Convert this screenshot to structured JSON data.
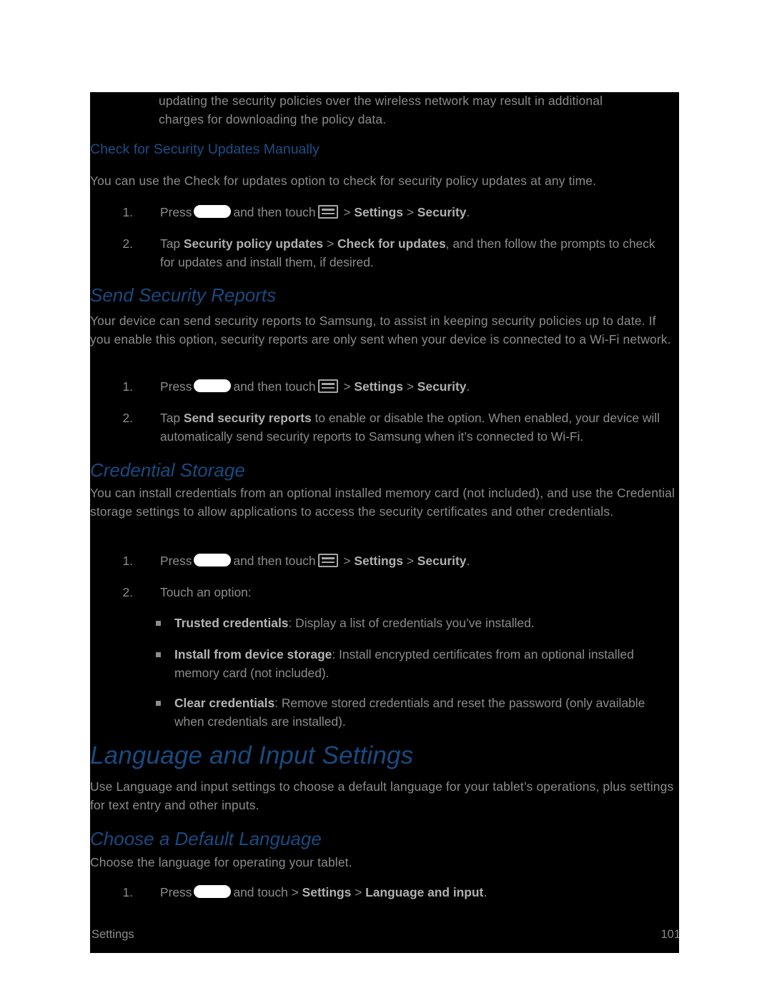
{
  "page": {
    "background_color": "#ffffff",
    "sheet_color": "#000000",
    "body_text_color": "#8c8c8c",
    "heading_color": "#1a4a80"
  },
  "intro": {
    "continued_paragraph": "updating the security policies over the wireless network may result in additional charges for downloading the policy data."
  },
  "section_check_updates": {
    "heading": "Check for Security Updates Manually",
    "paragraph": "You can use the Check for updates option to check for security policy updates at any time.",
    "steps": [
      {
        "number": "1.",
        "before_home": "Press",
        "between_keys": "and then touch",
        "after_menu_plain": " > ",
        "bold_1": "Settings",
        "sep": " > ",
        "bold_2": "Security",
        "tail": "."
      },
      {
        "number": "2.",
        "text_lead": "Tap ",
        "bold_1": "Security policy updates",
        "mid": " > ",
        "bold_2": "Check for updates",
        "tail": ", and then follow the prompts to check for updates and install them, if desired."
      }
    ]
  },
  "section_send_reports": {
    "heading": "Send Security Reports",
    "paragraph": "Your device can send security reports to Samsung, to assist in keeping security policies up to date. If you enable this option, security reports are only sent when your device is connected to a Wi-Fi network.",
    "steps": [
      {
        "number": "1.",
        "before_home": "Press",
        "between_keys": "and then touch",
        "after_menu_plain": " > ",
        "bold_1": "Settings",
        "sep": " > ",
        "bold_2": "Security",
        "tail": "."
      },
      {
        "number": "2.",
        "text_lead": "Tap ",
        "bold_1": "Send security reports",
        "tail": " to enable or disable the option. When enabled, your device will automatically send security reports to Samsung when it’s connected to Wi-Fi."
      }
    ]
  },
  "section_credential_storage": {
    "heading": "Credential Storage",
    "paragraph": "You can install credentials from an optional installed memory card (not included), and use the Credential storage settings to allow applications to access the security certificates and other credentials.",
    "steps": [
      {
        "number": "1.",
        "before_home": "Press",
        "between_keys": "and then touch",
        "after_menu_plain": " > ",
        "bold_1": "Settings",
        "sep": " > ",
        "bold_2": "Security",
        "tail": "."
      },
      {
        "number": "2.",
        "text_plain": "Touch an option:"
      }
    ],
    "options": [
      {
        "term": "Trusted credentials",
        "definition": ": Display a list of credentials you’ve installed."
      },
      {
        "term": "Install from device storage",
        "definition": ": Install encrypted certificates from an optional installed memory card (not included)."
      },
      {
        "term": "Clear credentials",
        "definition": ": Remove stored credentials and reset the password (only available when credentials are installed)."
      }
    ]
  },
  "section_language_input": {
    "heading": "Language and Input Settings",
    "paragraph": "Use Language and input settings to choose a default language for your tablet’s operations, plus settings for text entry and other inputs."
  },
  "section_default_language": {
    "heading": "Choose a Default Language",
    "paragraph": "Choose the language for operating your tablet.",
    "steps": [
      {
        "number": "1.",
        "before_home": "Press",
        "after_home": "and touch > ",
        "bold_1": "Settings",
        "sep": " > ",
        "bold_2": "Language and input",
        "tail": "."
      }
    ]
  },
  "footer": {
    "left_label": "Settings",
    "page_number": "101"
  },
  "icons": {
    "home_key": "home-key-icon",
    "menu_key": "menu-key-icon"
  }
}
